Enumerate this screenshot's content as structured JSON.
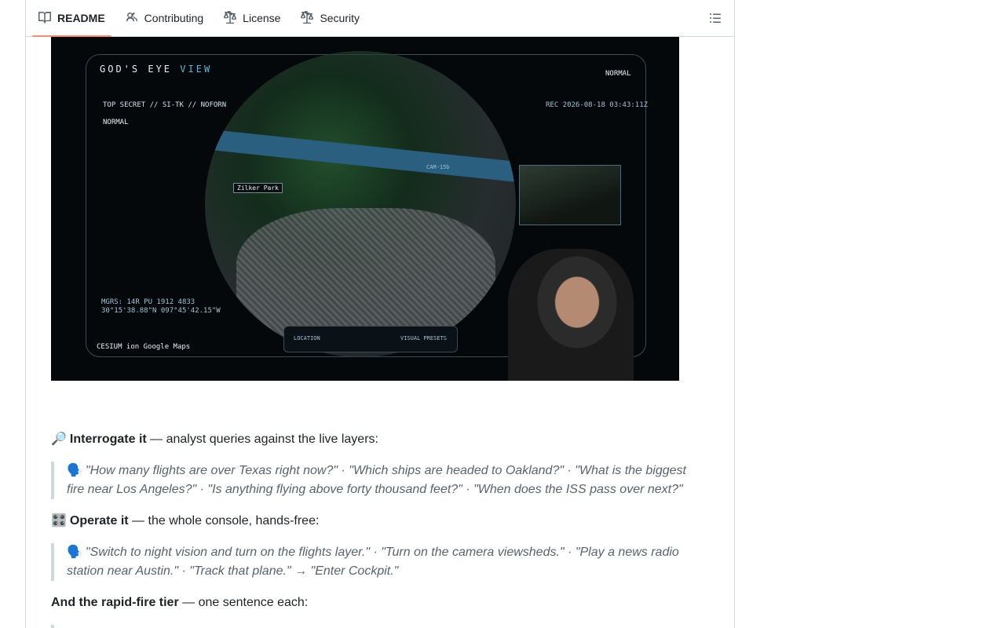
{
  "tabs": [
    {
      "label": "README",
      "icon": "book-icon"
    },
    {
      "label": "Contributing",
      "icon": "people-icon"
    },
    {
      "label": "License",
      "icon": "law-icon"
    },
    {
      "label": "Security",
      "icon": "law-icon"
    }
  ],
  "screenshot": {
    "title_main": "GOD'S EYE",
    "title_accent": "VIEW",
    "subtitle": "TOP SECRET // SI-TK // NOFORN",
    "mode": "NORMAL",
    "mode_right": "NORMAL",
    "timestamp": "REC 2026-08-18 03:43:11Z",
    "place_label": "Zilker Park",
    "coords_line1": "MGRS: 14R PU 1912 4833",
    "coords_line2": "30°15'38.88\"N 097°45'42.15\"W",
    "footer_brand": "CESIUM ion  Google Maps",
    "btn_location": "LOCATION",
    "btn_visual_presets": "VISUAL PRESETS",
    "cam_label": "CAM-15b"
  },
  "section1": {
    "emoji": "🔎",
    "bold": "Interrogate it",
    "rest": " — analyst queries against the live layers:"
  },
  "quote1": {
    "emoji": "🗣️",
    "line1": "\"How many flights are over Texas right now?\" · \"Which ships are headed to Oakland?\" · \"What is the biggest",
    "line2": "fire near Los Angeles?\" · \"Is anything flying above forty thousand feet?\" · \"When does the ISS pass over next?\""
  },
  "section2": {
    "emoji": "🎛️",
    "bold": "Operate it",
    "rest": " — the whole console, hands-free:"
  },
  "quote2": {
    "emoji": "🗣️",
    "line1": "\"Switch to night vision and turn on the flights layer.\" · \"Turn on the camera viewsheds.\" · \"Play a news radio",
    "line2": "station near Austin.\" · \"Track that plane.\" → \"Enter Cockpit.\""
  },
  "section3": {
    "bold": "And the rapid-fire tier",
    "rest": " — one sentence each:"
  }
}
